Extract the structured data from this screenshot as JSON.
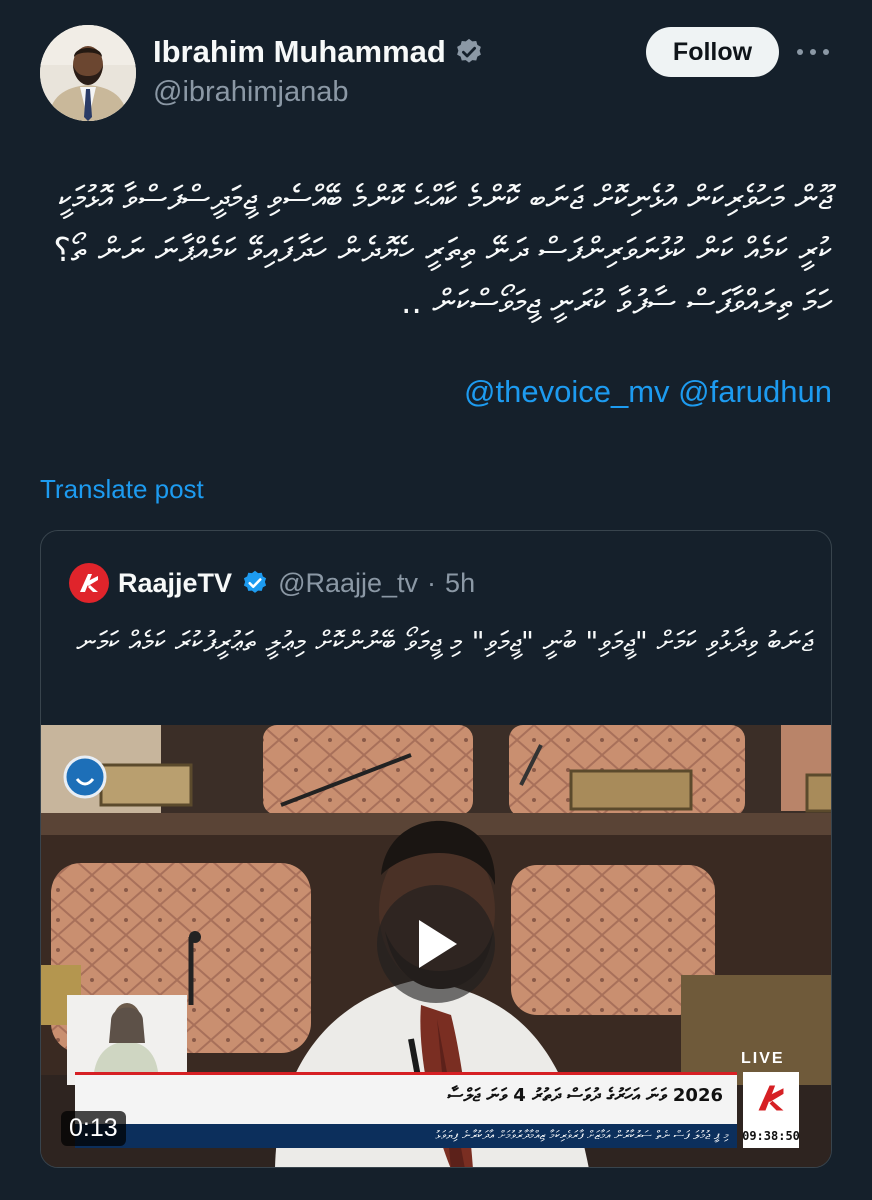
{
  "author": {
    "name": "Ibrahim Muhammad",
    "handle": "@ibrahimjanab",
    "verified": true
  },
  "actions": {
    "follow_label": "Follow",
    "more_icon": "more-horizontal-icon"
  },
  "post": {
    "text": "ޖޫން މަހުވެރިކަން އުޅެނިކޮށް ޖަނަބ ކޮންމެ ކާއްޙެ ކޮންމެ ބޭއްސެވި ޖީމަދީސްފަސްވާ އޮޅުމަކީ ކުރީ ކަމެއް ކަން ކުޅުނަވަރިންފަސް ދަނޭ ތިތަރީ ހެޔޮދެން ހަދާފައިވޭ ކަމެއްޕާނަ ނަން ތޯ؟ ހަމަ ތިލައްވާފަސް ސާފުވާ ކުރަނީ ޖީމަވޯސްކަން ..",
    "mentions": "@thevoice_mv @farudhun",
    "translate_label": "Translate post"
  },
  "quote": {
    "name": "RaajjeTV",
    "handle": "@Raajje_tv",
    "separator": "·",
    "time": "5h",
    "text": "ޖަނަބު ވިދާޅުވި ކަމަށް \"ޖީމަވި\" ބުނީ \"ޖީމަވި\" މި ޖީމަވޯ ބޭނުންކޮށް މިޢުލީ ތަޢުރީފުކުރަ ކަމެއް ކަމަނ",
    "video": {
      "duration": "0:13",
      "live_label": "LIVE",
      "ticker_headline": "2026 ވަނަ އަހަރުގެ ދުވަސް ދަތުރު 4 ވަނަ ޖަލްސާ",
      "ticker_crawl": "މި ޕީ ޖުމުލަ ފަސް ނެތް ސަރުކާރުން އަމާޒަށް ފާރަވެރިކަމާ ޒިއްމާދާރުވުމަށް އާދަކުރާނެ ފިޔަވަޅު",
      "clock": "09:38:50",
      "play_icon": "play-icon"
    }
  },
  "colors": {
    "background": "#15202b",
    "accent": "#1d9bf0",
    "verified": "#1d9bf0",
    "follow_bg": "#eff3f4",
    "secondary_text": "#8b98a5"
  }
}
